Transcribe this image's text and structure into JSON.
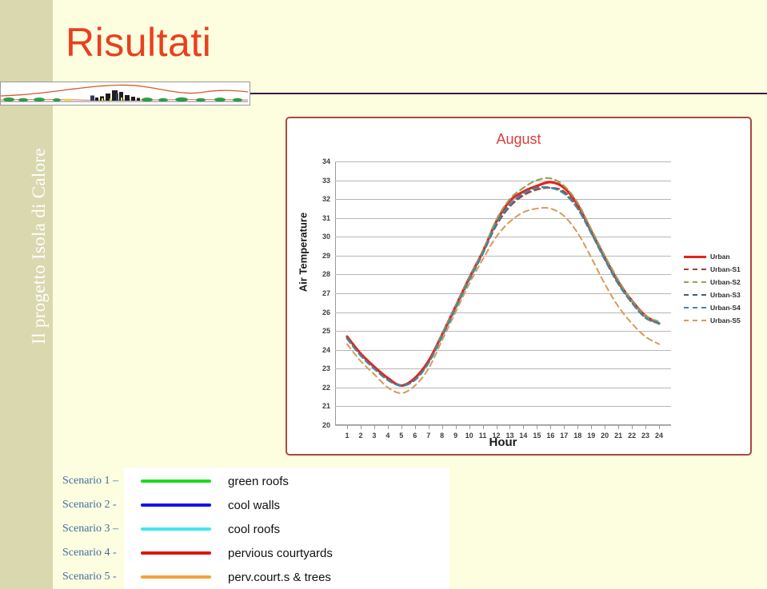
{
  "page": {
    "title": "Risultati",
    "title_color": "#e8401f",
    "sidebar_title": "Il progetto Isola di Calore",
    "sidebar_bg": "#d9d8ae",
    "background": "#fdfddf",
    "rule_color": "#3a1b47",
    "banner_icon": "city-skyline-banner"
  },
  "chart_data": {
    "type": "line",
    "title": "August",
    "title_color": "#d9413a",
    "xlabel": "Hour",
    "ylabel": "Air Temperature",
    "ylim": [
      20,
      34
    ],
    "xlim": [
      1,
      24
    ],
    "grid": true,
    "legend_position": "right",
    "yticks": [
      34,
      33,
      32,
      31,
      30,
      29,
      28,
      27,
      26,
      25,
      24,
      23,
      22,
      21,
      20
    ],
    "x": [
      1,
      2,
      3,
      4,
      5,
      6,
      7,
      8,
      9,
      10,
      11,
      12,
      13,
      14,
      15,
      16,
      17,
      18,
      19,
      20,
      21,
      22,
      23,
      24
    ],
    "series": [
      {
        "name": "Urban",
        "color": "#e8231a",
        "style": "solid",
        "width": 3.2,
        "values": [
          24.7,
          23.8,
          23.1,
          22.5,
          22.1,
          22.5,
          23.4,
          24.8,
          26.3,
          27.8,
          29.2,
          30.8,
          31.9,
          32.4,
          32.7,
          32.9,
          32.6,
          31.7,
          30.3,
          28.9,
          27.6,
          26.6,
          25.8,
          25.4
        ]
      },
      {
        "name": "Urban-S1",
        "color": "#9c4339",
        "style": "dashed",
        "width": 2.2,
        "values": [
          24.6,
          23.7,
          23.0,
          22.4,
          22.1,
          22.4,
          23.3,
          24.7,
          26.2,
          27.7,
          29.1,
          30.6,
          31.6,
          32.2,
          32.5,
          32.6,
          32.4,
          31.5,
          30.2,
          28.8,
          27.5,
          26.5,
          25.7,
          25.4
        ]
      },
      {
        "name": "Urban-S2",
        "color": "#96a257",
        "style": "dashed",
        "width": 2.2,
        "values": [
          24.6,
          23.7,
          23.0,
          22.4,
          22.1,
          22.4,
          23.3,
          24.8,
          26.3,
          27.8,
          29.2,
          30.9,
          32.0,
          32.6,
          33.0,
          33.1,
          32.7,
          31.8,
          30.4,
          29.0,
          27.7,
          26.6,
          25.8,
          25.5
        ]
      },
      {
        "name": "Urban-S3",
        "color": "#4a5b72",
        "style": "dashed",
        "width": 2.4,
        "values": [
          24.6,
          23.7,
          23.0,
          22.4,
          22.1,
          22.4,
          23.3,
          24.7,
          26.2,
          27.7,
          29.1,
          30.7,
          31.7,
          32.3,
          32.6,
          32.6,
          32.3,
          31.5,
          30.2,
          28.8,
          27.5,
          26.5,
          25.7,
          25.4
        ]
      },
      {
        "name": "Urban-S4",
        "color": "#3d89a8",
        "style": "dashed",
        "width": 2.2,
        "values": [
          24.6,
          23.7,
          23.0,
          22.4,
          22.1,
          22.4,
          23.3,
          24.7,
          26.2,
          27.7,
          29.1,
          30.7,
          31.7,
          32.3,
          32.6,
          32.6,
          32.3,
          31.5,
          30.2,
          28.8,
          27.5,
          26.5,
          25.7,
          25.4
        ]
      },
      {
        "name": "Urban-S5",
        "color": "#d79a58",
        "style": "dashed",
        "width": 2.0,
        "values": [
          24.3,
          23.4,
          22.7,
          22.0,
          21.7,
          22.1,
          23.0,
          24.5,
          26.0,
          27.5,
          28.8,
          30.0,
          30.8,
          31.3,
          31.5,
          31.5,
          31.1,
          30.2,
          28.9,
          27.5,
          26.3,
          25.4,
          24.7,
          24.3
        ]
      }
    ]
  },
  "scenarios": [
    {
      "name": "Scenario 1 –",
      "color": "#19dd19",
      "description": "green roofs"
    },
    {
      "name": "Scenario 2 -",
      "color": "#1414e6",
      "description": "cool walls"
    },
    {
      "name": "Scenario 3 –",
      "color": "#3ee8f0",
      "description": "cool roofs"
    },
    {
      "name": "Scenario 4 -",
      "color": "#e01414",
      "description": "pervious courtyards"
    },
    {
      "name": "Scenario 5 -",
      "color": "#f2a33c",
      "description": "perv.court.s & trees"
    }
  ]
}
